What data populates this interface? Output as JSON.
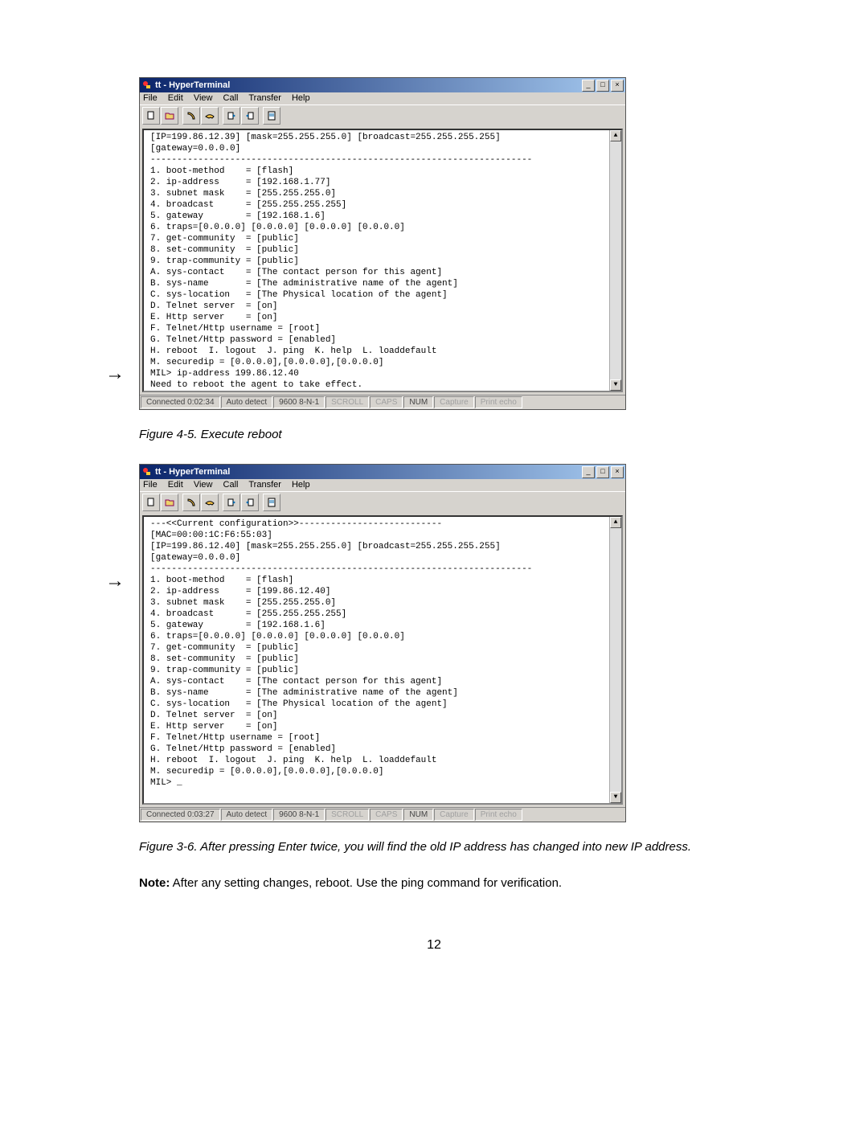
{
  "window_title": "tt - HyperTerminal",
  "menus": [
    "File",
    "Edit",
    "View",
    "Call",
    "Transfer",
    "Help"
  ],
  "toolbar_icons": [
    "new-file-icon",
    "open-folder-icon",
    "dial-icon",
    "hangup-icon",
    "send-icon",
    "receive-icon",
    "properties-icon"
  ],
  "winbuttons": {
    "min": "_",
    "max": "□",
    "close": "×"
  },
  "scroll": {
    "up": "▲",
    "down": "▼"
  },
  "arrow_glyph": "→",
  "terminal1_text": "[IP=199.86.12.39] [mask=255.255.255.0] [broadcast=255.255.255.255]\n[gateway=0.0.0.0]\n------------------------------------------------------------------------\n1. boot-method    = [flash]\n2. ip-address     = [192.168.1.77]\n3. subnet mask    = [255.255.255.0]\n4. broadcast      = [255.255.255.255]\n5. gateway        = [192.168.1.6]\n6. traps=[0.0.0.0] [0.0.0.0] [0.0.0.0] [0.0.0.0]\n7. get-community  = [public]\n8. set-community  = [public]\n9. trap-community = [public]\nA. sys-contact    = [The contact person for this agent]\nB. sys-name       = [The administrative name of the agent]\nC. sys-location   = [The Physical location of the agent]\nD. Telnet server  = [on]\nE. Http server    = [on]\nF. Telnet/Http username = [root]\nG. Telnet/Http password = [enabled]\nH. reboot  I. logout  J. ping  K. help  L. loaddefault\nM. securedip = [0.0.0.0],[0.0.0.0],[0.0.0.0]\nMIL> ip-address 199.86.12.40\nNeed to reboot the agent to take effect.\nMIL> reboot_",
  "terminal2_text": "---<<Current configuration>>---------------------------\n[MAC=00:00:1C:F6:55:03]\n[IP=199.86.12.40] [mask=255.255.255.0] [broadcast=255.255.255.255]\n[gateway=0.0.0.0]\n------------------------------------------------------------------------\n1. boot-method    = [flash]\n2. ip-address     = [199.86.12.40]\n3. subnet mask    = [255.255.255.0]\n4. broadcast      = [255.255.255.255]\n5. gateway        = [192.168.1.6]\n6. traps=[0.0.0.0] [0.0.0.0] [0.0.0.0] [0.0.0.0]\n7. get-community  = [public]\n8. set-community  = [public]\n9. trap-community = [public]\nA. sys-contact    = [The contact person for this agent]\nB. sys-name       = [The administrative name of the agent]\nC. sys-location   = [The Physical location of the agent]\nD. Telnet server  = [on]\nE. Http server    = [on]\nF. Telnet/Http username = [root]\nG. Telnet/Http password = [enabled]\nH. reboot  I. logout  J. ping  K. help  L. loaddefault\nM. securedip = [0.0.0.0],[0.0.0.0],[0.0.0.0]\nMIL> _",
  "status1": {
    "conn": "Connected 0:02:34",
    "auto": "Auto detect",
    "enc": "9600 8-N-1",
    "scroll": "SCROLL",
    "caps": "CAPS",
    "num": "NUM",
    "cap": "Capture",
    "pe": "Print echo"
  },
  "status2": {
    "conn": "Connected 0:03:27",
    "auto": "Auto detect",
    "enc": "9600 8-N-1",
    "scroll": "SCROLL",
    "caps": "CAPS",
    "num": "NUM",
    "cap": "Capture",
    "pe": "Print echo"
  },
  "caption1": "Figure 4-5. Execute reboot",
  "caption2": "Figure 3-6. After pressing Enter twice, you will find the old IP address has changed into new IP address.",
  "note_label": "Note:",
  "note_text": " After any setting changes, reboot. Use the ping command for verification.",
  "page_number": "12"
}
